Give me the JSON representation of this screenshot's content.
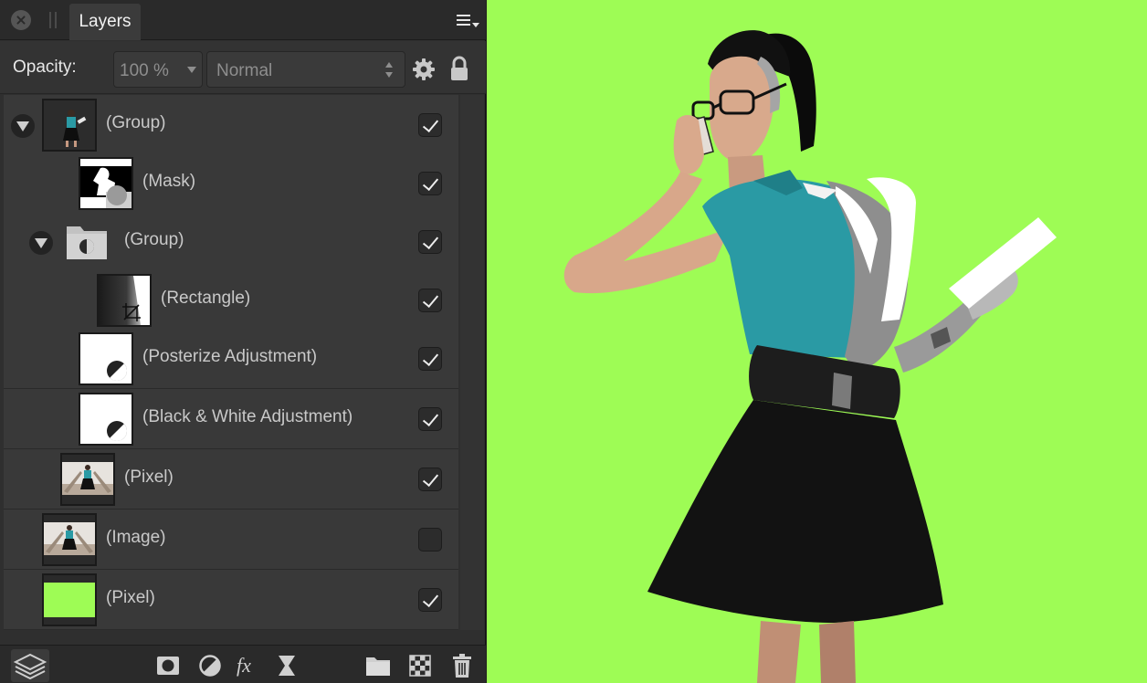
{
  "panel": {
    "tab_label": "Layers",
    "opacity_label": "Opacity:",
    "opacity_value": "100 %",
    "blend_mode": "Normal"
  },
  "layers": [
    {
      "name": "(Group)",
      "visible": true
    },
    {
      "name": "(Mask)",
      "visible": true
    },
    {
      "name": "(Group)",
      "visible": true
    },
    {
      "name": "(Rectangle)",
      "visible": true
    },
    {
      "name": "(Posterize Adjustment)",
      "visible": true
    },
    {
      "name": "(Black & White Adjustment)",
      "visible": true
    },
    {
      "name": "(Pixel)",
      "visible": true
    },
    {
      "name": "(Image)",
      "visible": false
    },
    {
      "name": "(Pixel)",
      "visible": true
    }
  ],
  "colors": {
    "canvas_background": "#9efc55",
    "fill_layer": "#9efc55",
    "shirt_teal": "#2a9aa4"
  },
  "icons": {
    "close": "close-icon",
    "menu": "panel-menu-icon",
    "settings": "gear-icon",
    "lock": "lock-icon",
    "layers_stack": "layers-stack-icon",
    "mask": "mask-icon",
    "adjustment": "adjustment-icon",
    "fx": "fx-icon",
    "live_filter": "live-filter-icon",
    "group_folder": "folder-icon",
    "pixel_layer": "checker-icon",
    "delete": "trash-icon"
  }
}
